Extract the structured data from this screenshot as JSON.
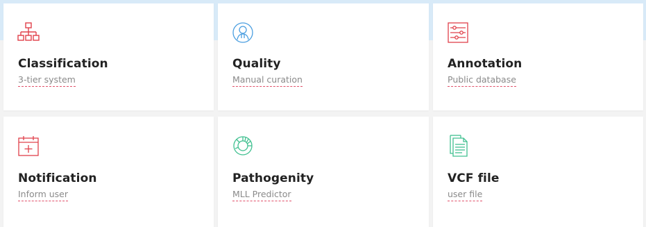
{
  "cards": [
    {
      "title": "Classification",
      "subtitle": "3-tier system",
      "icon": "hierarchy-icon",
      "icon_color": "#e0404a"
    },
    {
      "title": "Quality",
      "subtitle": "Manual curation",
      "icon": "user-icon",
      "icon_color": "#4a9ee0"
    },
    {
      "title": "Annotation",
      "subtitle": "Public database",
      "icon": "sliders-icon",
      "icon_color": "#e0404a"
    },
    {
      "title": "Notification",
      "subtitle": "Inform user",
      "icon": "calendar-add-icon",
      "icon_color": "#e0404a"
    },
    {
      "title": "Pathogenity",
      "subtitle": "MLL Predictor",
      "icon": "chart-ring-icon",
      "icon_color": "#40c090"
    },
    {
      "title": "VCF file",
      "subtitle": "user file",
      "icon": "document-icon",
      "icon_color": "#40c090"
    }
  ],
  "colors": {
    "top_band": "#d8eaf8",
    "card_background": "#ffffff",
    "page_background": "#f3f3f3",
    "title": "#222222",
    "subtitle": "#8a8a8a",
    "underline": "#e0506a"
  }
}
